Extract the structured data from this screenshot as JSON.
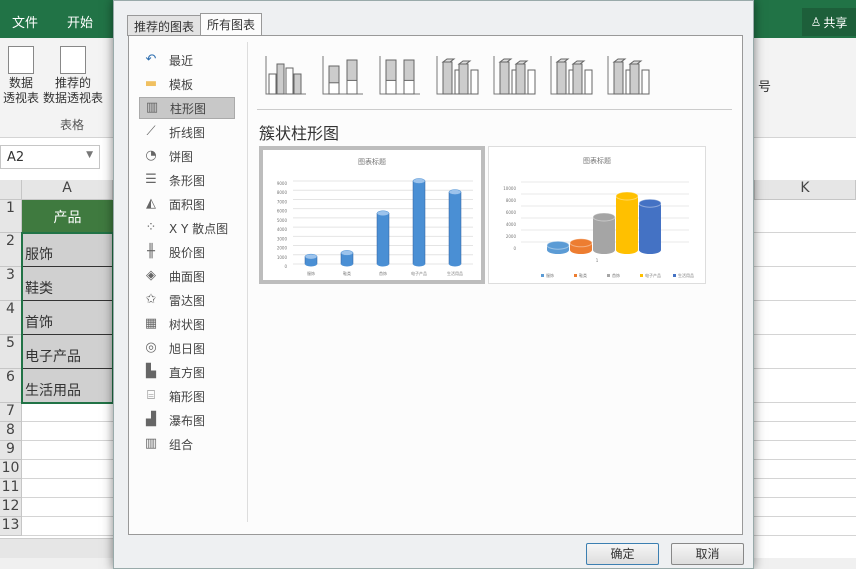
{
  "ribbon": {
    "tabs": [
      "文件",
      "开始"
    ],
    "share": "共享",
    "pivot": [
      "数据",
      "透视表"
    ],
    "recommended_pivot": [
      "推荐的",
      "数据透视表"
    ],
    "group": "表格",
    "right_label": "号"
  },
  "namebox": "A2",
  "sheet": {
    "col_a": "A",
    "col_k": "K",
    "rows": [
      "1",
      "2",
      "3",
      "4",
      "5",
      "6",
      "7",
      "8",
      "9",
      "10",
      "11",
      "12",
      "13"
    ],
    "cells": [
      "产品",
      "服饰",
      "鞋类",
      "首饰",
      "电子产品",
      "生活用品"
    ]
  },
  "dialog": {
    "tabs": [
      "推荐的图表",
      "所有图表"
    ],
    "categories": [
      {
        "label": "最近",
        "icon": "undo-icon"
      },
      {
        "label": "模板",
        "icon": "folder-icon"
      },
      {
        "label": "柱形图",
        "icon": "column-chart-icon"
      },
      {
        "label": "折线图",
        "icon": "line-chart-icon"
      },
      {
        "label": "饼图",
        "icon": "pie-chart-icon"
      },
      {
        "label": "条形图",
        "icon": "bar-chart-icon"
      },
      {
        "label": "面积图",
        "icon": "area-chart-icon"
      },
      {
        "label": "X Y 散点图",
        "icon": "scatter-chart-icon"
      },
      {
        "label": "股价图",
        "icon": "stock-chart-icon"
      },
      {
        "label": "曲面图",
        "icon": "surface-chart-icon"
      },
      {
        "label": "雷达图",
        "icon": "radar-chart-icon"
      },
      {
        "label": "树状图",
        "icon": "treemap-icon"
      },
      {
        "label": "旭日图",
        "icon": "sunburst-icon"
      },
      {
        "label": "直方图",
        "icon": "histogram-icon"
      },
      {
        "label": "箱形图",
        "icon": "box-whisker-icon"
      },
      {
        "label": "瀑布图",
        "icon": "waterfall-icon"
      },
      {
        "label": "组合",
        "icon": "combo-chart-icon"
      }
    ],
    "selected_category": "柱形图",
    "subtype_title": "簇状柱形图",
    "ok": "确定",
    "cancel": "取消"
  },
  "chart_data": [
    {
      "type": "bar",
      "title": "图表标题",
      "categories": [
        "服饰",
        "鞋类",
        "首饰",
        "电子产品",
        "生活用品"
      ],
      "values": [
        800,
        1200,
        5500,
        9000,
        7800
      ],
      "ylim": [
        0,
        9000
      ],
      "yticks": [
        "0",
        "1000",
        "2000",
        "3000",
        "4000",
        "5000",
        "6000",
        "7000",
        "8000",
        "9000"
      ],
      "color": "#4a8fd4"
    },
    {
      "type": "bar",
      "title": "图表标题",
      "categories": [
        "1"
      ],
      "series": [
        {
          "name": "服饰",
          "value": 800,
          "color": "#5b9bd5"
        },
        {
          "name": "鞋类",
          "value": 1200,
          "color": "#ed7d31"
        },
        {
          "name": "首饰",
          "value": 5500,
          "color": "#a5a5a5"
        },
        {
          "name": "电子产品",
          "value": 9000,
          "color": "#ffc000"
        },
        {
          "name": "生活用品",
          "value": 7800,
          "color": "#4472c4"
        }
      ],
      "ylim": [
        0,
        10000
      ],
      "yticks": [
        "0",
        "2000",
        "4000",
        "6000",
        "8000",
        "10000"
      ],
      "legend": "bottom"
    }
  ]
}
